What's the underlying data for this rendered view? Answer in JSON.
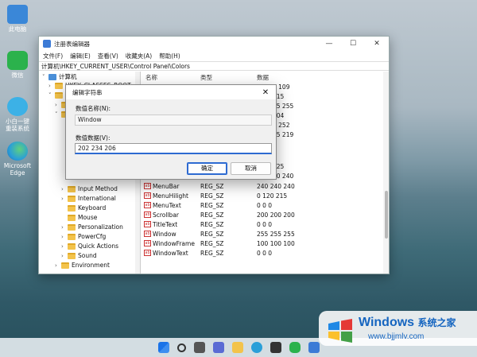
{
  "desktop": [
    {
      "label": "此电脑",
      "color": "#3a87d8"
    },
    {
      "label": "微信",
      "color": "#2bb24c"
    },
    {
      "label": "小白一键重装系统",
      "color": "#3cb1e6"
    },
    {
      "label": "Microsoft Edge",
      "color": "#2a9fd8"
    }
  ],
  "window": {
    "title": "注册表编辑器",
    "menu": [
      "文件(F)",
      "编辑(E)",
      "查看(V)",
      "收藏夹(A)",
      "帮助(H)"
    ],
    "address": "计算机\\HKEY_CURRENT_USER\\Control Panel\\Colors",
    "tree_root": "计算机",
    "tree_hidden": "HKEY_CLASSES_ROOT",
    "tree_items": [
      "Input Method",
      "International",
      "Keyboard",
      "Mouse",
      "Personalization",
      "PowerCfg",
      "Quick Actions",
      "Sound",
      "Environment"
    ],
    "columns": {
      "name": "名称",
      "type": "类型",
      "data": "数据"
    },
    "partial_values": [
      "9 109",
      "215",
      "55 255",
      "204",
      "7 252",
      "55 219",
      "225",
      "50 240"
    ],
    "rows": [
      {
        "name": "MenuBar",
        "type": "REG_SZ",
        "data": "240 240 240"
      },
      {
        "name": "MenuHilight",
        "type": "REG_SZ",
        "data": "0 120 215"
      },
      {
        "name": "MenuText",
        "type": "REG_SZ",
        "data": "0 0 0"
      },
      {
        "name": "Scrollbar",
        "type": "REG_SZ",
        "data": "200 200 200"
      },
      {
        "name": "TitleText",
        "type": "REG_SZ",
        "data": "0 0 0"
      },
      {
        "name": "Window",
        "type": "REG_SZ",
        "data": "255 255 255"
      },
      {
        "name": "WindowFrame",
        "type": "REG_SZ",
        "data": "100 100 100"
      },
      {
        "name": "WindowText",
        "type": "REG_SZ",
        "data": "0 0 0"
      }
    ],
    "ab_icon": "ab"
  },
  "dialog": {
    "title": "编辑字符串",
    "name_label": "数值名称(N):",
    "name_value": "Window",
    "data_label": "数值数据(V):",
    "data_value": "202 234 206",
    "ok": "确定",
    "cancel": "取消"
  },
  "watermark": {
    "brand": "Windows",
    "cn": "系统之家",
    "url": "www.bjjmlv.com"
  }
}
